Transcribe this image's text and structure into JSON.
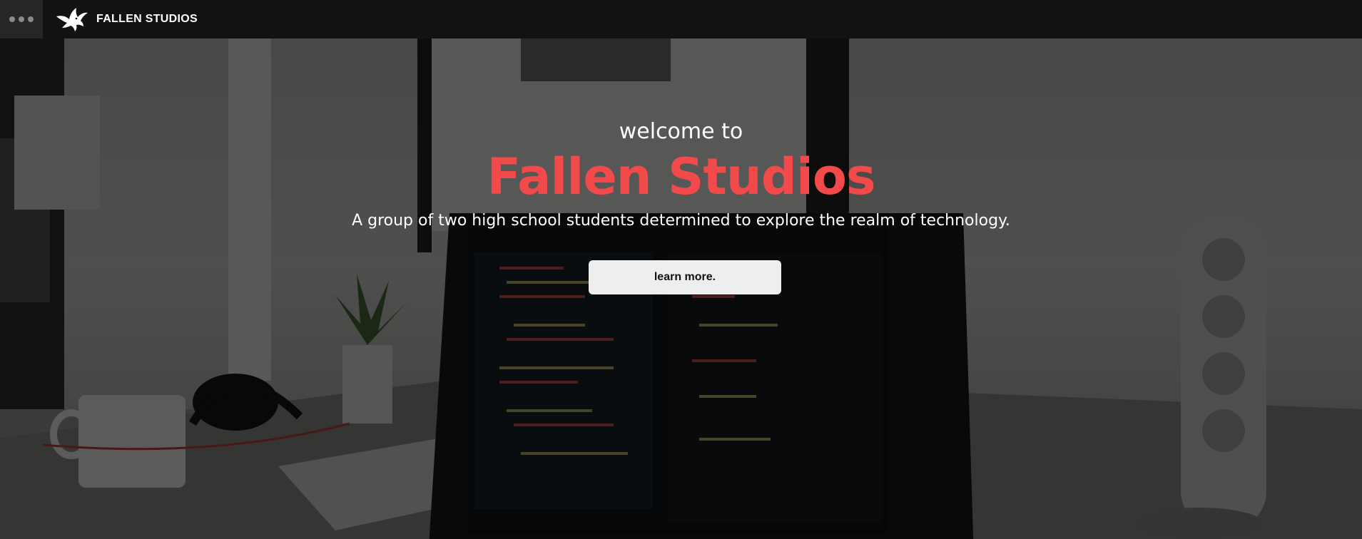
{
  "navbar": {
    "menu_icon": "ellipsis-menu-icon",
    "logo_icon": "bird-logo-icon",
    "brand_name": "FALLEN STUDIOS"
  },
  "hero": {
    "welcome_text": "welcome to",
    "title": "Fallen Studios",
    "tagline": "A group of two high school students determined to explore the realm of technology.",
    "cta_label": "learn more.",
    "background_image": "desk-with-laptop-code-editor-photo"
  },
  "colors": {
    "navbar_bg": "#121212",
    "title_accent": "#f24a4a",
    "button_bg": "#eeeeee",
    "text_light": "#ffffff"
  }
}
